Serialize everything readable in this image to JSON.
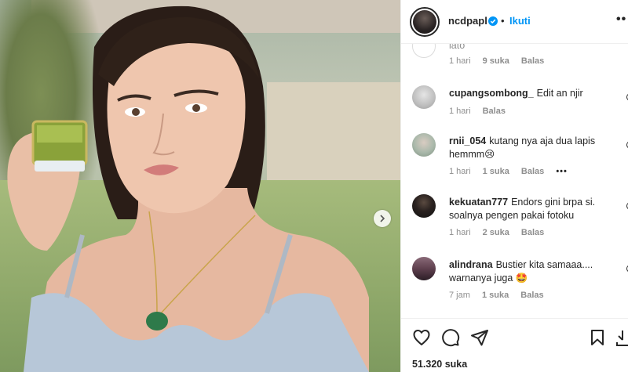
{
  "post": {
    "username": "ncdpapl",
    "separator": "•",
    "follow_label": "Ikuti",
    "more_label": "••",
    "likes_count": "51.320",
    "likes_suffix": "suka"
  },
  "comments": [
    {
      "username": "",
      "text": "lato",
      "time": "1 hari",
      "likes": "9 suka",
      "reply": "Balas",
      "partial": true
    },
    {
      "username": "cupangsombong_",
      "text": "Edit an njir",
      "time": "1 hari",
      "likes": "",
      "reply": "Balas",
      "avatar_color": "#c9c9c9"
    },
    {
      "username": "rnii_054",
      "text": "kutang nya aja dua lapis hemmm😢",
      "time": "1 hari",
      "likes": "1 suka",
      "reply": "Balas",
      "more": "•••",
      "avatar_color": "#b9c7bb"
    },
    {
      "username": "kekuatan777",
      "text": "Endors gini brpa si. soalnya pengen pakai fotoku",
      "time": "1 hari",
      "likes": "2 suka",
      "reply": "Balas",
      "avatar_color": "#1f1f1f"
    },
    {
      "username": "alindrana",
      "text": "Bustier kita samaaa.... warnanya juga 🤩",
      "time": "7 jam",
      "likes": "1 suka",
      "reply": "Balas",
      "avatar_color": "#6b4a58"
    }
  ],
  "icons": {
    "verified": "verified-badge-icon",
    "next": "chevron-right-icon",
    "like": "heart-icon",
    "comment": "comment-bubble-icon",
    "share": "paper-plane-icon",
    "save": "bookmark-icon",
    "download": "download-icon"
  },
  "colors": {
    "accent": "#0095f6",
    "text": "#262626",
    "muted": "#8e8e8e",
    "border": "#efefef"
  }
}
